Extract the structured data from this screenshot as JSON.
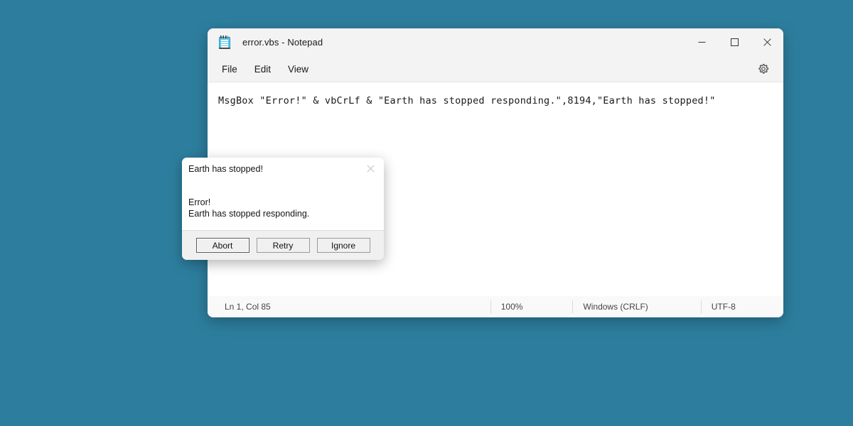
{
  "desktop": {
    "background_color": "#2d7e9e"
  },
  "notepad": {
    "title": "error.vbs - Notepad",
    "app_icon": "notepad-icon",
    "window_controls": {
      "minimize": "minimize-icon",
      "maximize": "maximize-icon",
      "close": "close-icon"
    },
    "menu": [
      {
        "label": "File"
      },
      {
        "label": "Edit"
      },
      {
        "label": "View"
      }
    ],
    "settings_icon": "gear-icon",
    "editor": {
      "content": "MsgBox \"Error!\" & vbCrLf & \"Earth has stopped responding.\",8194,\"Earth has stopped!\""
    },
    "statusbar": {
      "position": "Ln 1, Col 85",
      "zoom": "100%",
      "line_endings": "Windows (CRLF)",
      "encoding": "UTF-8"
    }
  },
  "dialog": {
    "title": "Earth has stopped!",
    "close_icon": "close-icon",
    "message_line1": "Error!",
    "message_line2": "Earth has stopped responding.",
    "buttons": [
      {
        "label": "Abort",
        "focused": true
      },
      {
        "label": "Retry",
        "focused": false
      },
      {
        "label": "Ignore",
        "focused": false
      }
    ]
  }
}
